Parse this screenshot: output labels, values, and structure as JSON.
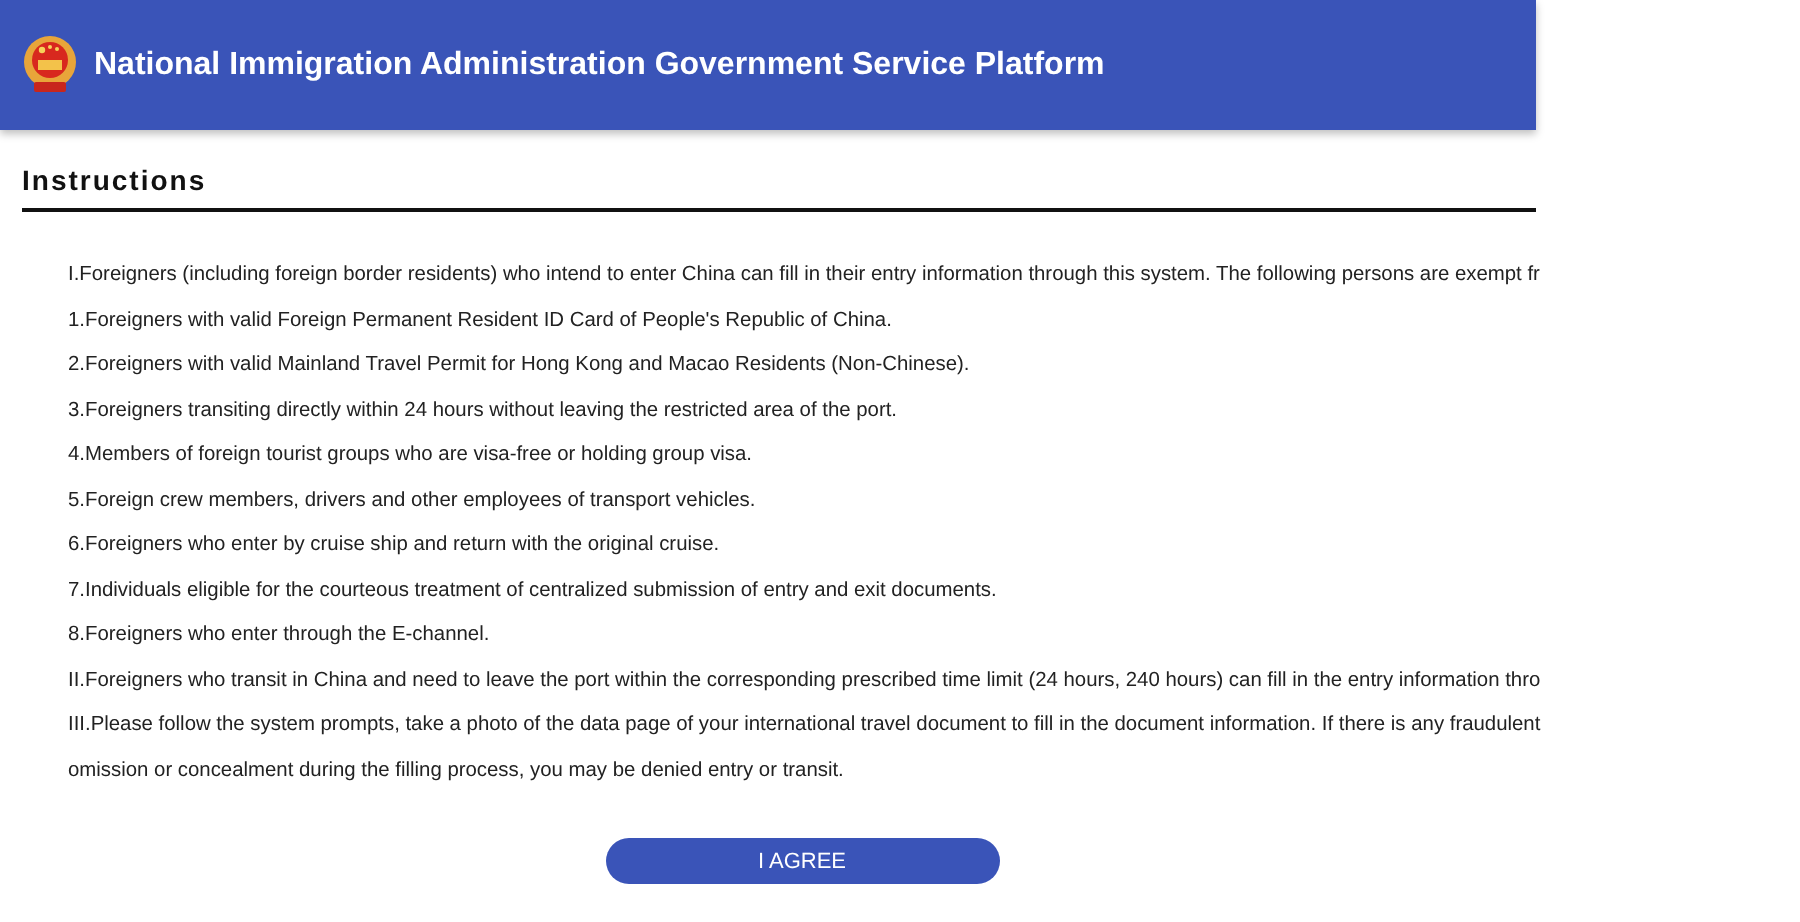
{
  "header": {
    "title": "National Immigration Administration Government Service Platform"
  },
  "section": {
    "title": "Instructions"
  },
  "paragraphs": [
    {
      "text": "I.Foreigners (including foreign border residents) who intend to enter China can fill in their entry information through this system. The following persons are exempt fr"
    },
    {
      "text": "1.Foreigners with valid Foreign Permanent Resident ID Card of People's Republic of China."
    },
    {
      "text": "2.Foreigners with valid Mainland Travel Permit for Hong Kong and Macao Residents (Non-Chinese)."
    },
    {
      "text": "3.Foreigners transiting directly within 24 hours without leaving the restricted area of the port."
    },
    {
      "text": "4.Members of foreign tourist groups who are visa-free or holding group visa."
    },
    {
      "text": "5.Foreign crew members, drivers and other employees of transport vehicles."
    },
    {
      "text": "6.Foreigners who enter by cruise ship and return with the original cruise."
    },
    {
      "text": "7.Individuals eligible for the courteous treatment of centralized submission of entry and exit documents."
    },
    {
      "text": "8.Foreigners who enter through the E-channel."
    },
    {
      "text": "II.Foreigners who transit in China and need to leave the port within the corresponding prescribed time limit (24 hours, 240 hours) can fill in the entry information thro"
    },
    {
      "text": "III.Please follow the system prompts, take a photo of the data page of your international travel document to fill in the document information. If there is any fraudulent omission or concealment during the filling process, you may be denied entry or transit."
    }
  ],
  "button": {
    "label": "I AGREE"
  }
}
